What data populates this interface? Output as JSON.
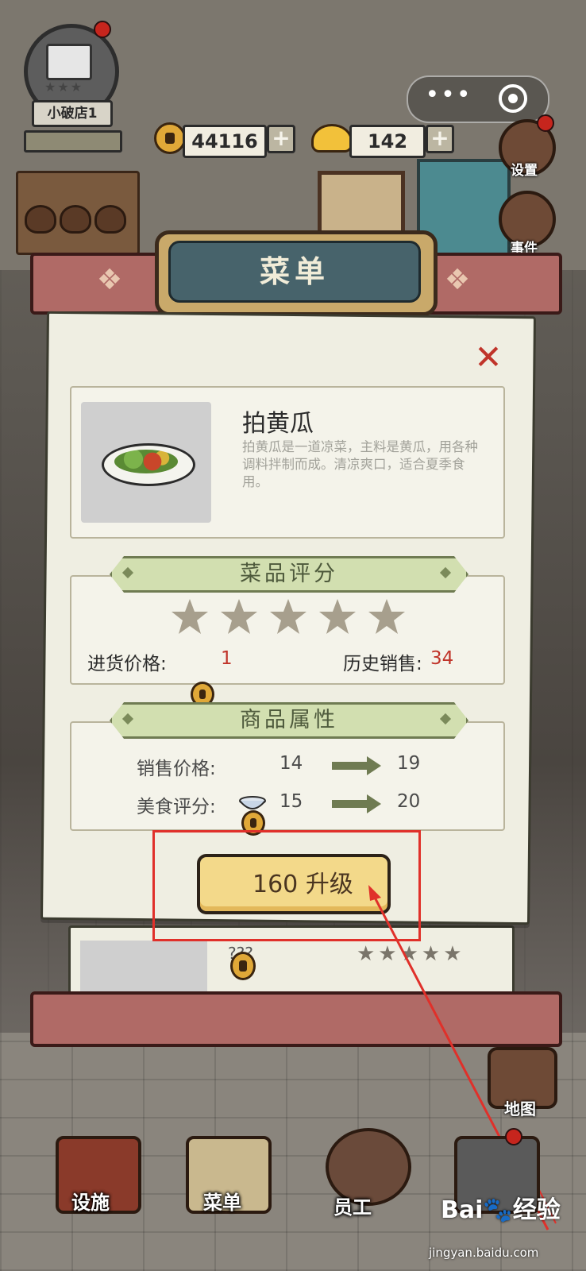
{
  "hud": {
    "shop_name": "小破店1",
    "copper_coins": "44116",
    "gold_ingots": "142",
    "plus": "+",
    "settings_label": "设置",
    "events_label": "事件",
    "map_label": "地图",
    "miniapp_more": "•••"
  },
  "menu": {
    "title": "菜单",
    "close": "✕",
    "dish": {
      "name": "拍黄瓜",
      "description": "拍黄瓜是一道凉菜，主料是黄瓜，用各种调料拌制而成。清凉爽口，适合夏季食用。"
    },
    "rating_section": {
      "title": "菜品评分",
      "stars": 5,
      "purchase_price_label": "进货价格:",
      "purchase_price": "1",
      "history_sales_label": "历史销售:",
      "history_sales": "34"
    },
    "attributes_section": {
      "title": "商品属性",
      "rows": [
        {
          "label": "销售价格:",
          "icon": "copper-coin-icon",
          "from": "14",
          "to": "19"
        },
        {
          "label": "美食评分:",
          "icon": "bowl-icon",
          "from": "15",
          "to": "20"
        }
      ]
    },
    "upgrade": {
      "cost": "160",
      "label": "升级"
    },
    "next_card": {
      "name": "???"
    }
  },
  "nav": {
    "facilities": "设施",
    "menu": "菜单",
    "staff": "员工"
  },
  "watermark": {
    "brand_left": "Bai",
    "brand_right": "经验",
    "url": "jingyan.baidu.com"
  },
  "colors": {
    "accent_red": "#c0342a",
    "ribbon_green": "#d2dfb0",
    "button_yellow": "#f3d98a",
    "scroll_pink": "#b06a66",
    "highlight": "#e0302a"
  }
}
